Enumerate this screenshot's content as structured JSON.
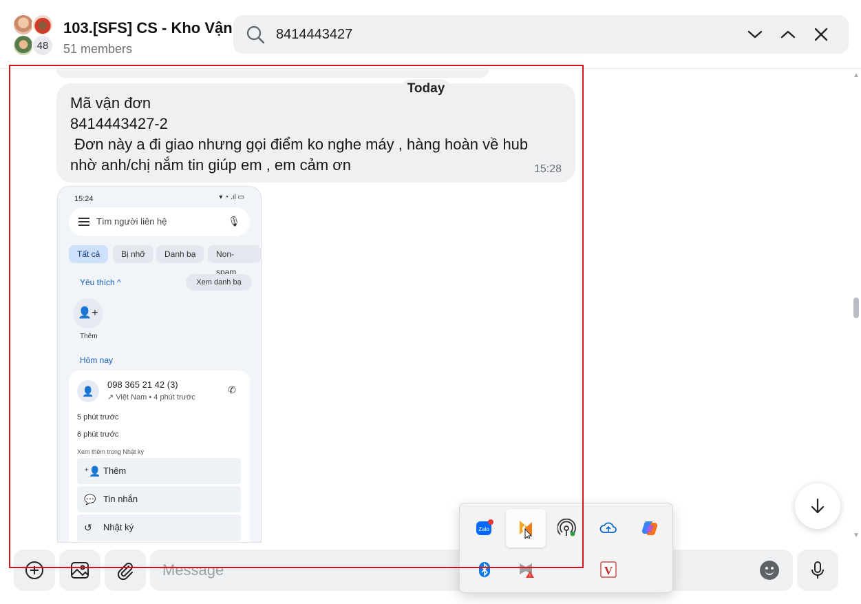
{
  "header": {
    "title": "103.[SFS] CS - Kho Vận",
    "members": "51 members",
    "avatar_more_count": "48"
  },
  "search": {
    "value": "8414443427"
  },
  "chat": {
    "date_separator": "Today",
    "message": {
      "lines": [
        "Mã vận đơn",
        "8414443427-2",
        " Đơn này a đi giao nhưng gọi điểm ko nghe máy , hàng hoàn về hub",
        "nhờ anh/chị nắm tin giúp em , em cảm ơn"
      ],
      "time": "15:28"
    },
    "screenshot": {
      "status_time": "15:24",
      "search_placeholder": "Tìm người liên hệ",
      "chips": [
        "Tất cả",
        "Bị nhỡ",
        "Danh bạ",
        "Non-spam"
      ],
      "favorites": "Yêu thích ^",
      "see_contacts": "Xem danh bạ",
      "add_label": "Thêm",
      "today_label": "Hôm nay",
      "call_number": "098 365 21 42 (3)",
      "call_sub": "↗ Việt Nam • 4 phút trước",
      "ago1": "5 phút trước",
      "ago2": "6 phút trước",
      "see_more_log": "Xem thêm trong Nhật ký",
      "actions": [
        "Thêm",
        "Tin nhắn",
        "Nhật ký"
      ]
    }
  },
  "composer": {
    "placeholder": "Message"
  },
  "tray": {
    "icons": [
      "zalo-icon",
      "app-icon",
      "hotspot-icon",
      "onedrive-icon",
      "copilot-icon",
      "bluetooth-icon",
      "mcafee-icon",
      "blank",
      "vietkey-icon"
    ]
  },
  "colors": {
    "bubble": "#eef0f2",
    "annotation": "#d0121b",
    "accent": "#1a5fb4"
  }
}
